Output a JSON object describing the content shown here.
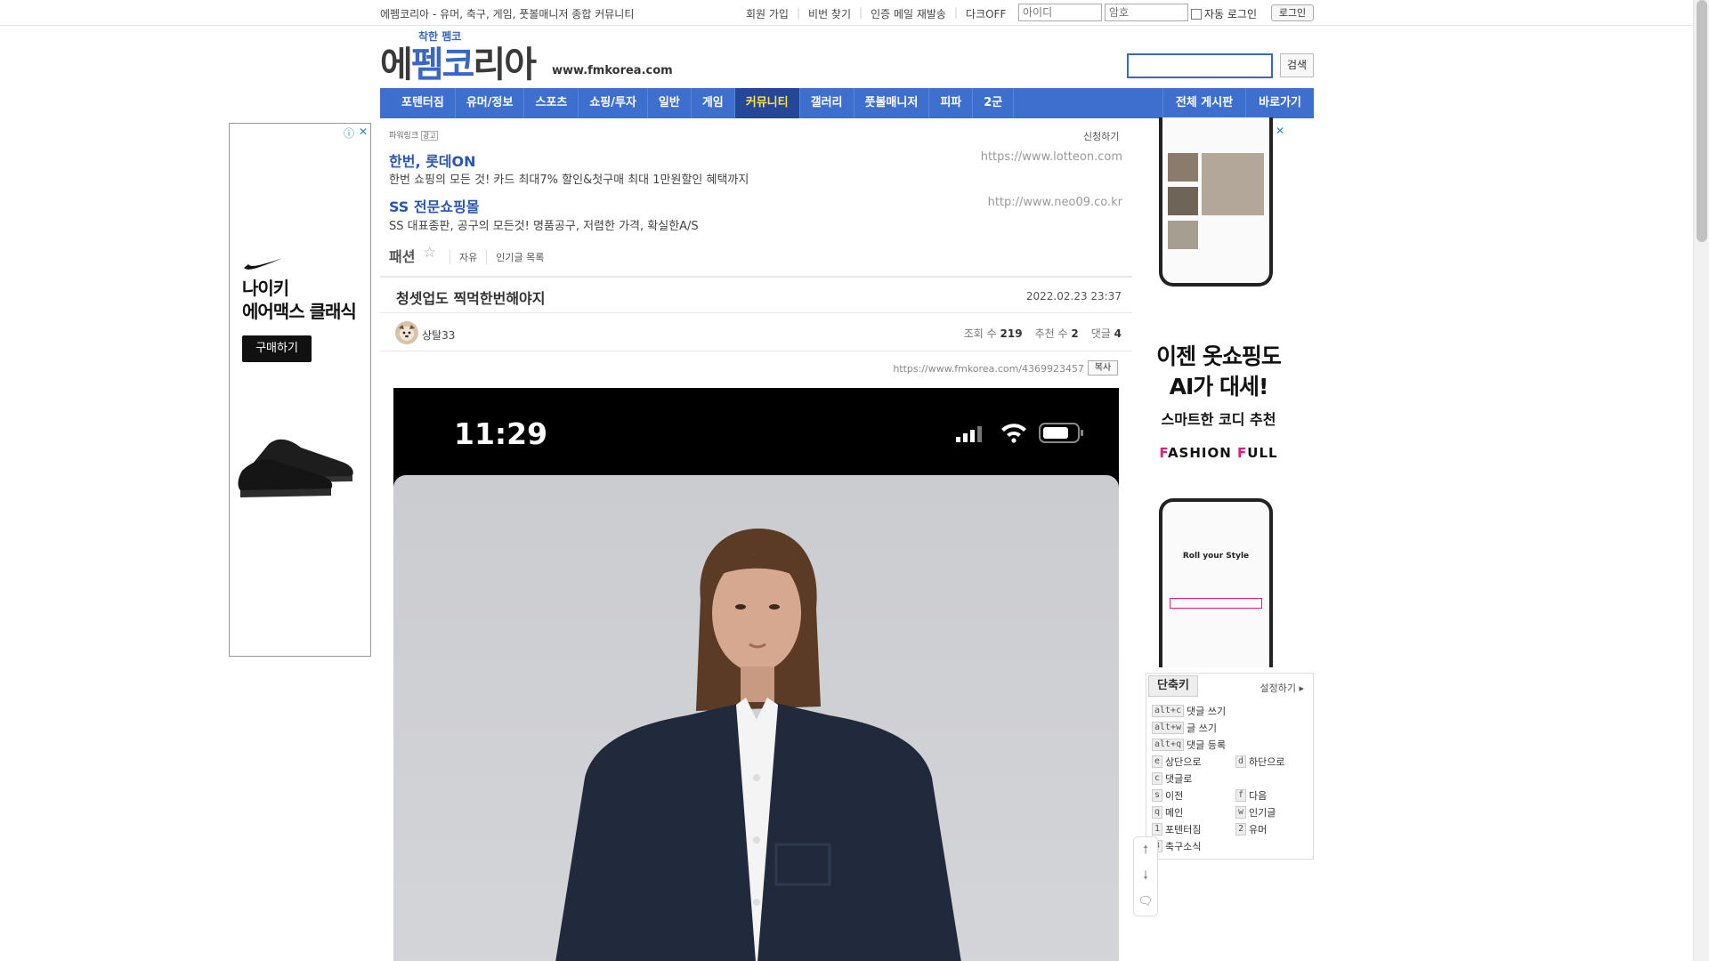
{
  "topbar": {
    "slogan": "에펨코리아 - 유머, 축구, 게임, 풋볼매니저 종합 커뮤니티",
    "links": [
      "회원 가입",
      "비번 찾기",
      "인증 메일 재발송",
      "다크OFF"
    ],
    "id_placeholder": "아이디",
    "pw_placeholder": "암호",
    "auto_login": "자동 로그인",
    "login_button": "로그인"
  },
  "logo": {
    "small": "착한 펨코",
    "main_pre": "에",
    "main_blue": "펨코",
    "main_post": "리아",
    "url": "www.fmkorea.com"
  },
  "search": {
    "button": "검색",
    "value": ""
  },
  "nav": {
    "items": [
      "포텐터짐",
      "유머/정보",
      "스포츠",
      "쇼핑/투자",
      "일반",
      "게임",
      "커뮤니티",
      "갤러리",
      "풋볼매니저",
      "피파",
      "2군"
    ],
    "active": "커뮤니티",
    "right_items": [
      "전체 게시판",
      "바로가기"
    ]
  },
  "left_ad": {
    "title_line1": "나이키",
    "title_line2": "에어맥스 클래식",
    "button": "구매하기"
  },
  "powerlink": {
    "label": "파워링크",
    "badge": "광고",
    "apply": "신청하기",
    "ads": [
      {
        "title": "한번, 롯데ON",
        "desc": "한번 쇼핑의 모든 것! 카드 최대7% 할인&첫구매 최대 1만원할인 혜택까지",
        "url": "https://www.lotteon.com"
      },
      {
        "title": "SS 전문쇼핑몰",
        "desc": "SS 대표종판, 공구의 모든것! 명품공구, 저렴한 가격, 확실한A/S",
        "url": "http://www.neo09.co.kr"
      }
    ]
  },
  "board": {
    "name": "패션",
    "links": [
      "자유",
      "인기글 목록"
    ]
  },
  "post": {
    "title": "청셋업도 찍먹한번해야지",
    "date": "2022.02.23 23:37",
    "author": "상탈33",
    "views_label": "조회 수",
    "views": "219",
    "votes_label": "추천 수",
    "votes": "2",
    "comments_label": "댓글",
    "comments": "4",
    "url": "https://www.fmkorea.com/4369923457",
    "copy": "복사",
    "image_time": "11:29"
  },
  "right_ad": {
    "line1": "이젠 옷쇼핑도",
    "line2": "AI가 대세!",
    "sub": "스마트한 코디 추천",
    "brand_f1": "F",
    "brand_rest1": "ASHION ",
    "brand_f2": "F",
    "brand_rest2": "ULL",
    "phone_title": "Roll your Style"
  },
  "shortcuts": {
    "tab": "단축키",
    "setting": "설정하기",
    "items": [
      {
        "key": "alt+c",
        "label": "댓글 쓰기"
      },
      {
        "key": "alt+w",
        "label": "글 쓰기"
      },
      {
        "key": "alt+q",
        "label": "댓글 등록"
      },
      {
        "key": "e",
        "label": "상단으로"
      },
      {
        "key": "d",
        "label": "하단으로"
      },
      {
        "key": "c",
        "label": "댓글로"
      },
      {
        "key": "s",
        "label": "이전"
      },
      {
        "key": "f",
        "label": "다음"
      },
      {
        "key": "q",
        "label": "메인"
      },
      {
        "key": "w",
        "label": "인기글"
      },
      {
        "key": "1",
        "label": "포텐터짐"
      },
      {
        "key": "2",
        "label": "유머"
      },
      {
        "key": "3",
        "label": "축구소식"
      }
    ]
  },
  "colors": {
    "nav_bg": "#3e6fcf",
    "nav_active": "#24479a",
    "link_blue": "#2a55b0",
    "brand_pink": "#e4197d"
  }
}
